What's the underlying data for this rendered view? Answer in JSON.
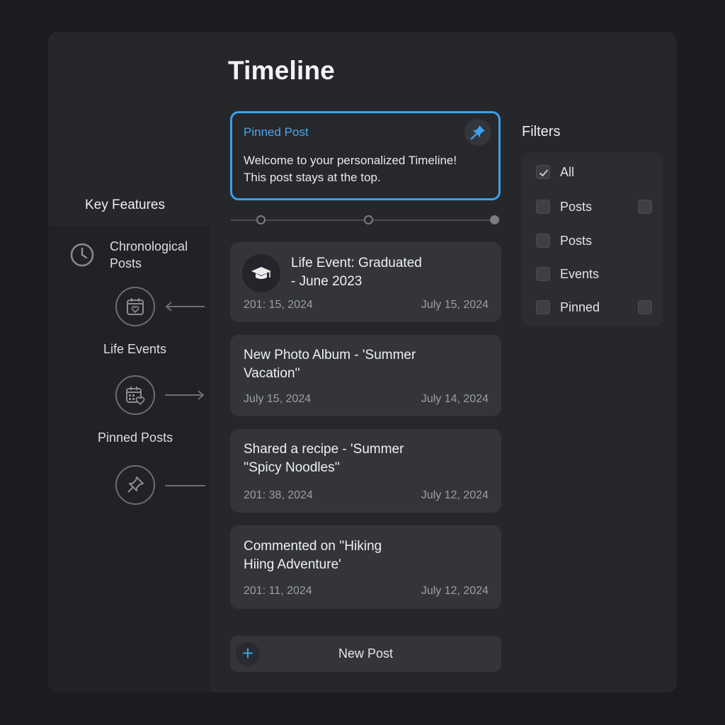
{
  "page": {
    "title": "Timeline"
  },
  "key_features": {
    "title": "Key Features",
    "items": [
      {
        "label": "Chronological Posts",
        "icon": "clock-icon"
      },
      {
        "label": "Life Events",
        "icon": "calendar-heart-icon"
      },
      {
        "label": "Pinned Posts",
        "icon": "pin-icon"
      }
    ],
    "chronological_line1": "Chronological",
    "chronological_line2": "Posts"
  },
  "pinned": {
    "label": "Pinned Post",
    "line1": "Welcome to your personalized Timeline!",
    "line2": "This post stays at the top."
  },
  "posts": [
    {
      "title_line1": "Life Event: Graduated",
      "title_line2": "- June 2023",
      "date_left": "201: 15, 2024",
      "date_right": "July 15, 2024",
      "icon": "graduation-cap-icon"
    },
    {
      "title_line1": "New Photo Album - 'Summer",
      "title_line2": "Vacation''",
      "date_left": "July 15, 2024",
      "date_right": "July 14, 2024"
    },
    {
      "title_line1": "Shared a recipe - 'Summer",
      "title_line2": "''Spicy Noodles''",
      "date_left": "201: 38, 2024",
      "date_right": "July 12, 2024"
    },
    {
      "title_line1": "Commented on ''Hiking",
      "title_line2": "Hiing Adventure'",
      "date_left": "201: 11, 2024",
      "date_right": "July 12, 2024"
    }
  ],
  "new_post": {
    "label": "New Post"
  },
  "filters": {
    "title": "Filters",
    "options": [
      {
        "label": "All",
        "checked": true
      },
      {
        "label": "Posts",
        "checked": false
      },
      {
        "label": "Posts",
        "checked": false
      },
      {
        "label": "Events",
        "checked": false
      },
      {
        "label": "Pinned",
        "checked": false
      }
    ]
  },
  "colors": {
    "accent": "#3aa0ec",
    "background": "#1b1c1f",
    "panel": "#26272b",
    "card": "#33353a"
  }
}
